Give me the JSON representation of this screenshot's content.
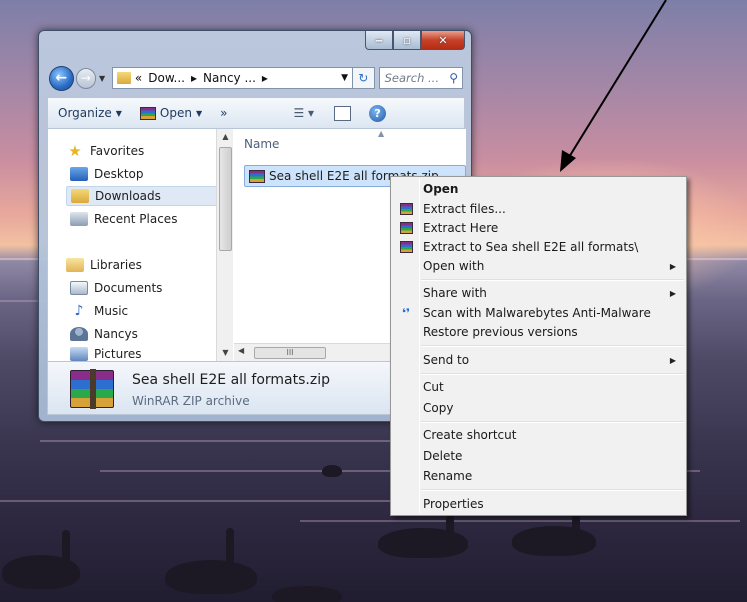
{
  "explorer": {
    "address": {
      "overflow": "«",
      "segments": [
        "Dow...",
        "Nancy ..."
      ],
      "search_placeholder": "Search ..."
    },
    "toolbar": {
      "organize": "Organize",
      "open": "Open",
      "more": "»"
    },
    "navpane": {
      "items": [
        {
          "label": "Favorites",
          "icon": "star-icon"
        },
        {
          "label": "Desktop",
          "icon": "desktop-icon"
        },
        {
          "label": "Downloads",
          "icon": "downloads-folder-icon",
          "selected": true
        },
        {
          "label": "Recent Places",
          "icon": "recent-places-icon"
        },
        {
          "label": "Libraries",
          "icon": "libraries-icon"
        },
        {
          "label": "Documents",
          "icon": "documents-icon"
        },
        {
          "label": "Music",
          "icon": "music-icon"
        },
        {
          "label": "Nancys",
          "icon": "user-icon"
        },
        {
          "label": "Pictures",
          "icon": "pictures-icon"
        }
      ]
    },
    "filepane": {
      "column_name": "Name",
      "file_name": "Sea shell E2E all formats.zip",
      "hscroll_grip": "III"
    },
    "details": {
      "name": "Sea shell E2E all formats.zip",
      "type": "WinRAR ZIP archive"
    }
  },
  "context_menu": {
    "open": "Open",
    "extract_files": "Extract files...",
    "extract_here": "Extract Here",
    "extract_to": "Extract to Sea shell E2E all formats\\",
    "open_with": "Open with",
    "share_with": "Share with",
    "scan": "Scan with Malwarebytes Anti-Malware",
    "restore": "Restore previous versions",
    "send_to": "Send to",
    "cut": "Cut",
    "copy": "Copy",
    "create_shortcut": "Create shortcut",
    "delete": "Delete",
    "rename": "Rename",
    "properties": "Properties"
  }
}
